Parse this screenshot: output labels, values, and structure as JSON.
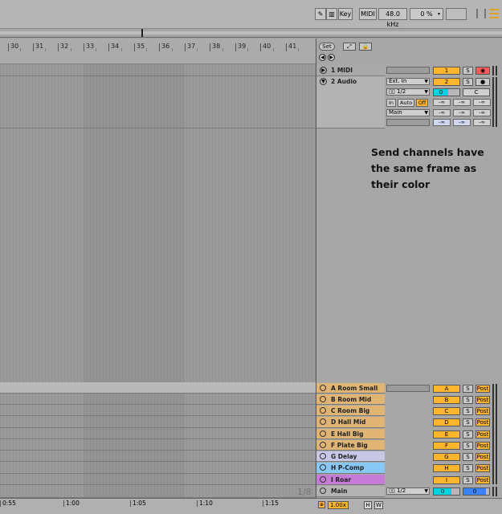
{
  "toolbar": {
    "key_label": "Key",
    "midi_label": "MIDI",
    "sample_rate": "48.0 kHz",
    "cpu_load": "0 %"
  },
  "ruler": {
    "bars": [
      "30",
      "31",
      "32",
      "33",
      "34",
      "35",
      "36",
      "37",
      "38",
      "39",
      "40",
      "41"
    ],
    "set_label": "Set"
  },
  "time_ruler": {
    "labels": [
      "0:55",
      "1:00",
      "1:05",
      "1:10",
      "1:15"
    ]
  },
  "tracks": [
    {
      "name": "1 MIDI",
      "number": "1"
    },
    {
      "name": "2 Audio",
      "number": "2",
      "input_type": "Ext. In",
      "input_channel": "1/2",
      "monitor": [
        "In",
        "Auto",
        "Off"
      ],
      "output": "Main",
      "pan": "0",
      "pan_mode": "C"
    }
  ],
  "volume_readouts": [
    "-∞",
    "-∞",
    "-∞",
    "-∞",
    "-∞",
    "-∞",
    "-∞",
    "-∞",
    "-∞"
  ],
  "annotation": "Send channels have the same frame as their color",
  "returns": [
    {
      "name": "A Room Small",
      "letter": "A",
      "post": "Post"
    },
    {
      "name": "B Room Mid",
      "letter": "B",
      "post": "Post"
    },
    {
      "name": "C Room Big",
      "letter": "C",
      "post": "Post"
    },
    {
      "name": "D Hall Mid",
      "letter": "D",
      "post": "Post"
    },
    {
      "name": "E Hall Big",
      "letter": "E",
      "post": "Post"
    },
    {
      "name": "F Plate Big",
      "letter": "F",
      "post": "Post"
    },
    {
      "name": "G Delay",
      "letter": "G",
      "post": "Post"
    },
    {
      "name": "H P-Comp",
      "letter": "H",
      "post": "Post"
    },
    {
      "name": "I Roar",
      "letter": "I",
      "post": "Post"
    }
  ],
  "main": {
    "name": "Main",
    "output": "1/2",
    "pan": "0",
    "volume": "0"
  },
  "page_indicator": "1/8",
  "bottom": {
    "zoom": "1.00x",
    "h_label": "H",
    "w_label": "W"
  },
  "solo_label": "S",
  "colors": {
    "orange_accent": "#ffb52e",
    "cyan_pan": "#00d4e0",
    "record_red": "#ff5a5a",
    "return_tan": "#e0b574",
    "return_lavender": "#c9c7e8",
    "return_blue": "#87c8f7",
    "return_purple": "#c67bd6"
  }
}
